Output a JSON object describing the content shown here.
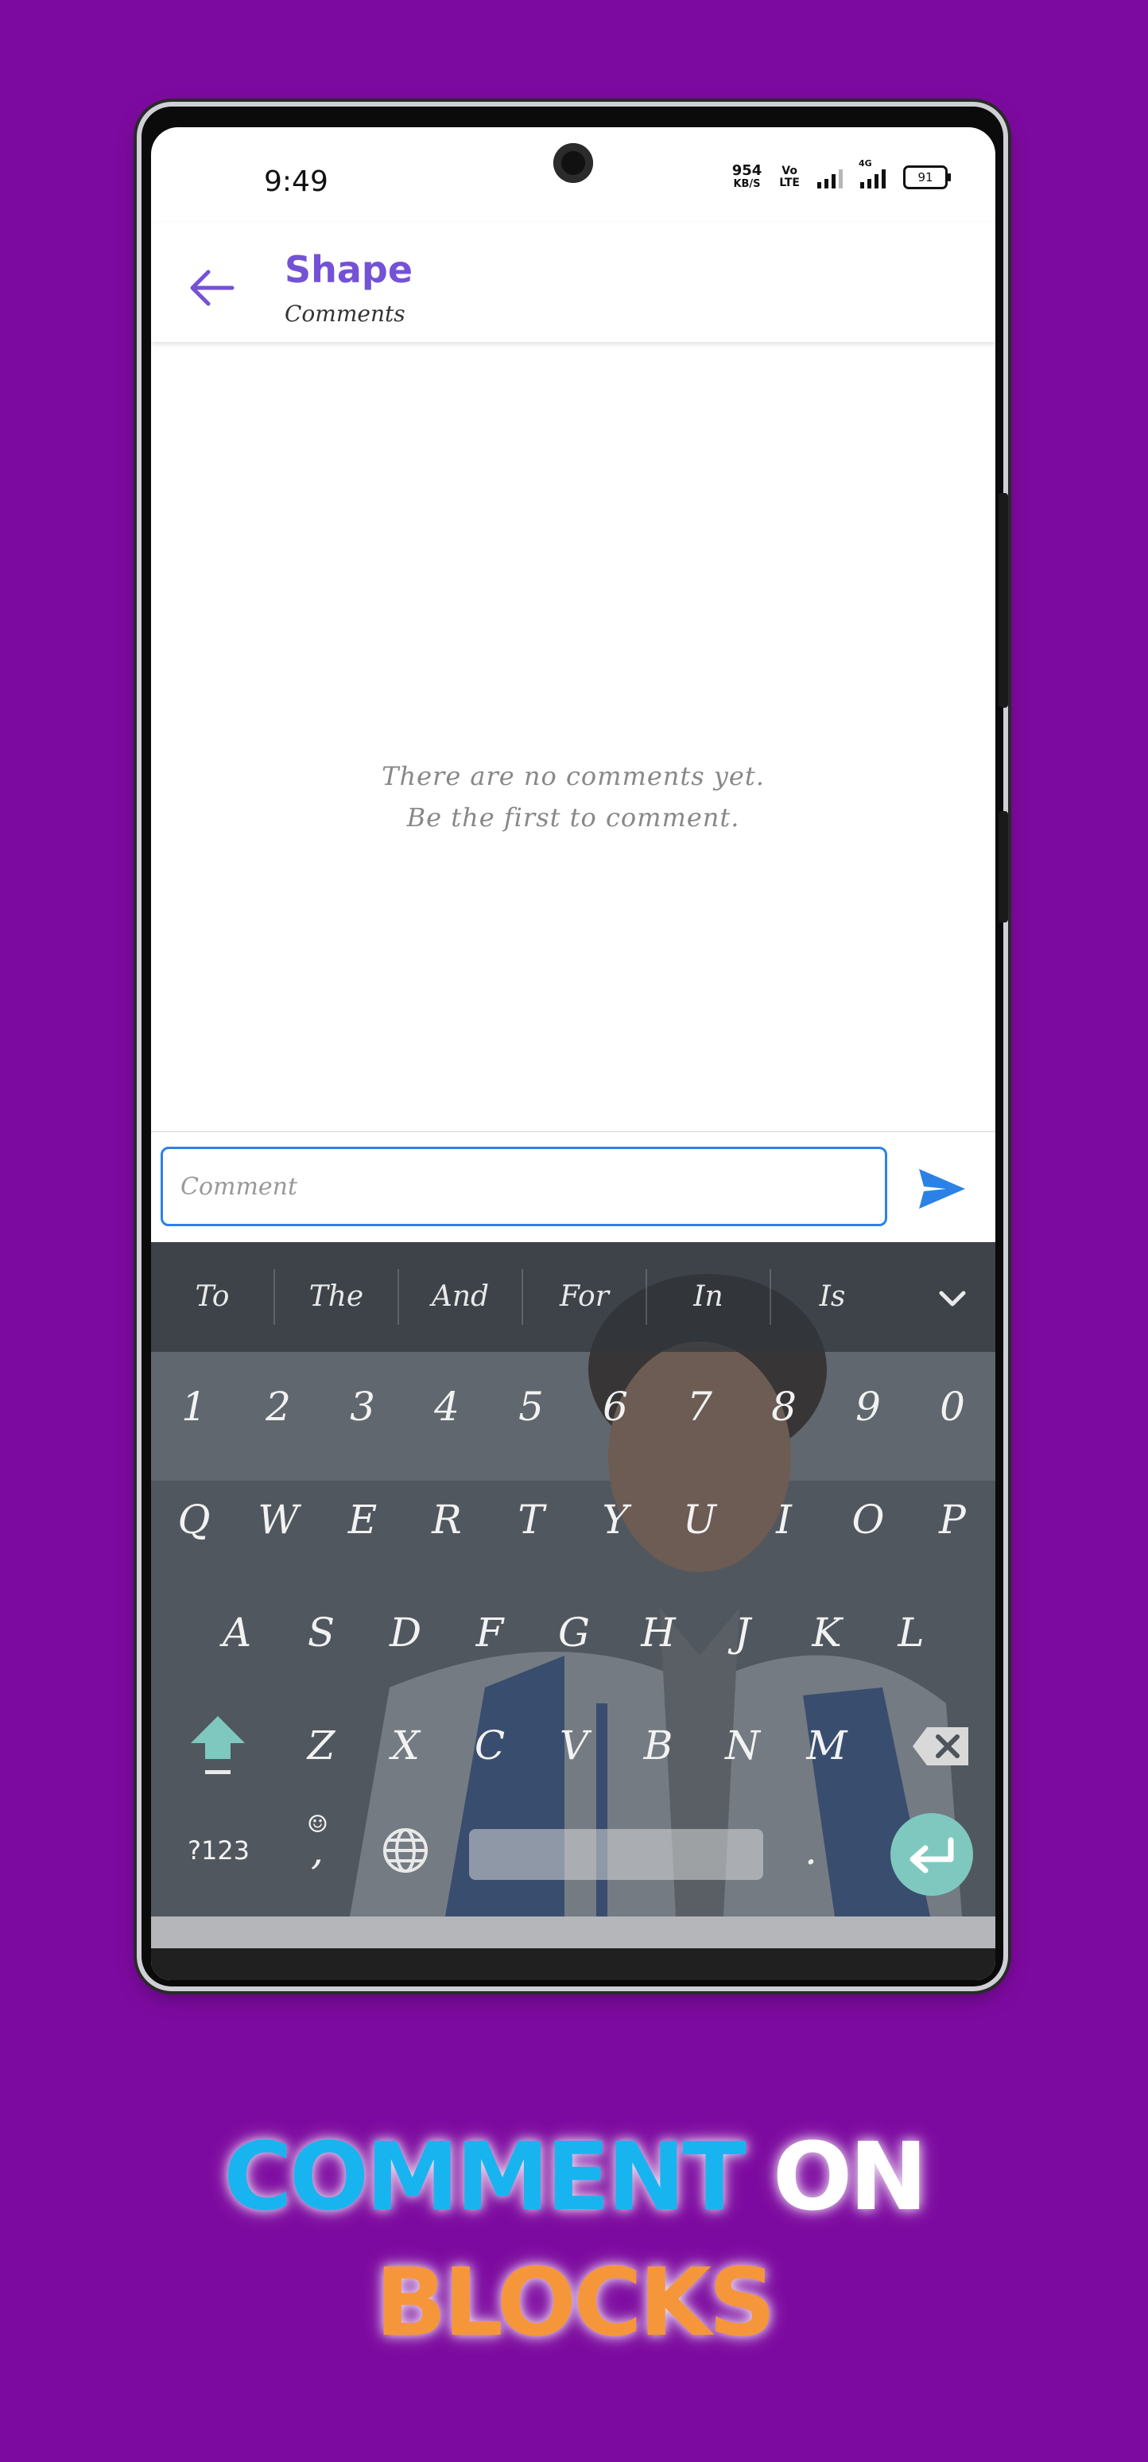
{
  "status_bar": {
    "time": "9:49",
    "net_speed_value": "954",
    "net_speed_unit": "KB/S",
    "volte_top": "Vo",
    "volte_bottom": "LTE",
    "network_type": "4G",
    "battery": "91"
  },
  "app_bar": {
    "title": "Shape",
    "subtitle": "Comments",
    "title_color": "#7452d6"
  },
  "empty_state": {
    "line1": "There are no comments yet.",
    "line2": "Be the first to comment."
  },
  "comment": {
    "placeholder": "Comment",
    "accent_color": "#2b82e6"
  },
  "keyboard": {
    "suggestions": [
      "To",
      "The",
      "And",
      "For",
      "In",
      "Is"
    ],
    "number_row": [
      "1",
      "2",
      "3",
      "4",
      "5",
      "6",
      "7",
      "8",
      "9",
      "0"
    ],
    "row1": [
      "Q",
      "W",
      "E",
      "R",
      "T",
      "Y",
      "U",
      "I",
      "O",
      "P"
    ],
    "row2": [
      "A",
      "S",
      "D",
      "F",
      "G",
      "H",
      "J",
      "K",
      "L"
    ],
    "row3": [
      "Z",
      "X",
      "C",
      "V",
      "B",
      "N",
      "M"
    ],
    "symbols_key": "?123",
    "comma_key": ",",
    "period_key": ".",
    "accent_color": "#7ec8c0"
  },
  "promo": {
    "word1": "COMMENT",
    "word2": "ON",
    "word3": "BLOCKS",
    "word1_color": "#18b4f0",
    "word2_color": "#ffffff",
    "word3_color": "#f5963a",
    "background_color": "#7d0aa0"
  }
}
